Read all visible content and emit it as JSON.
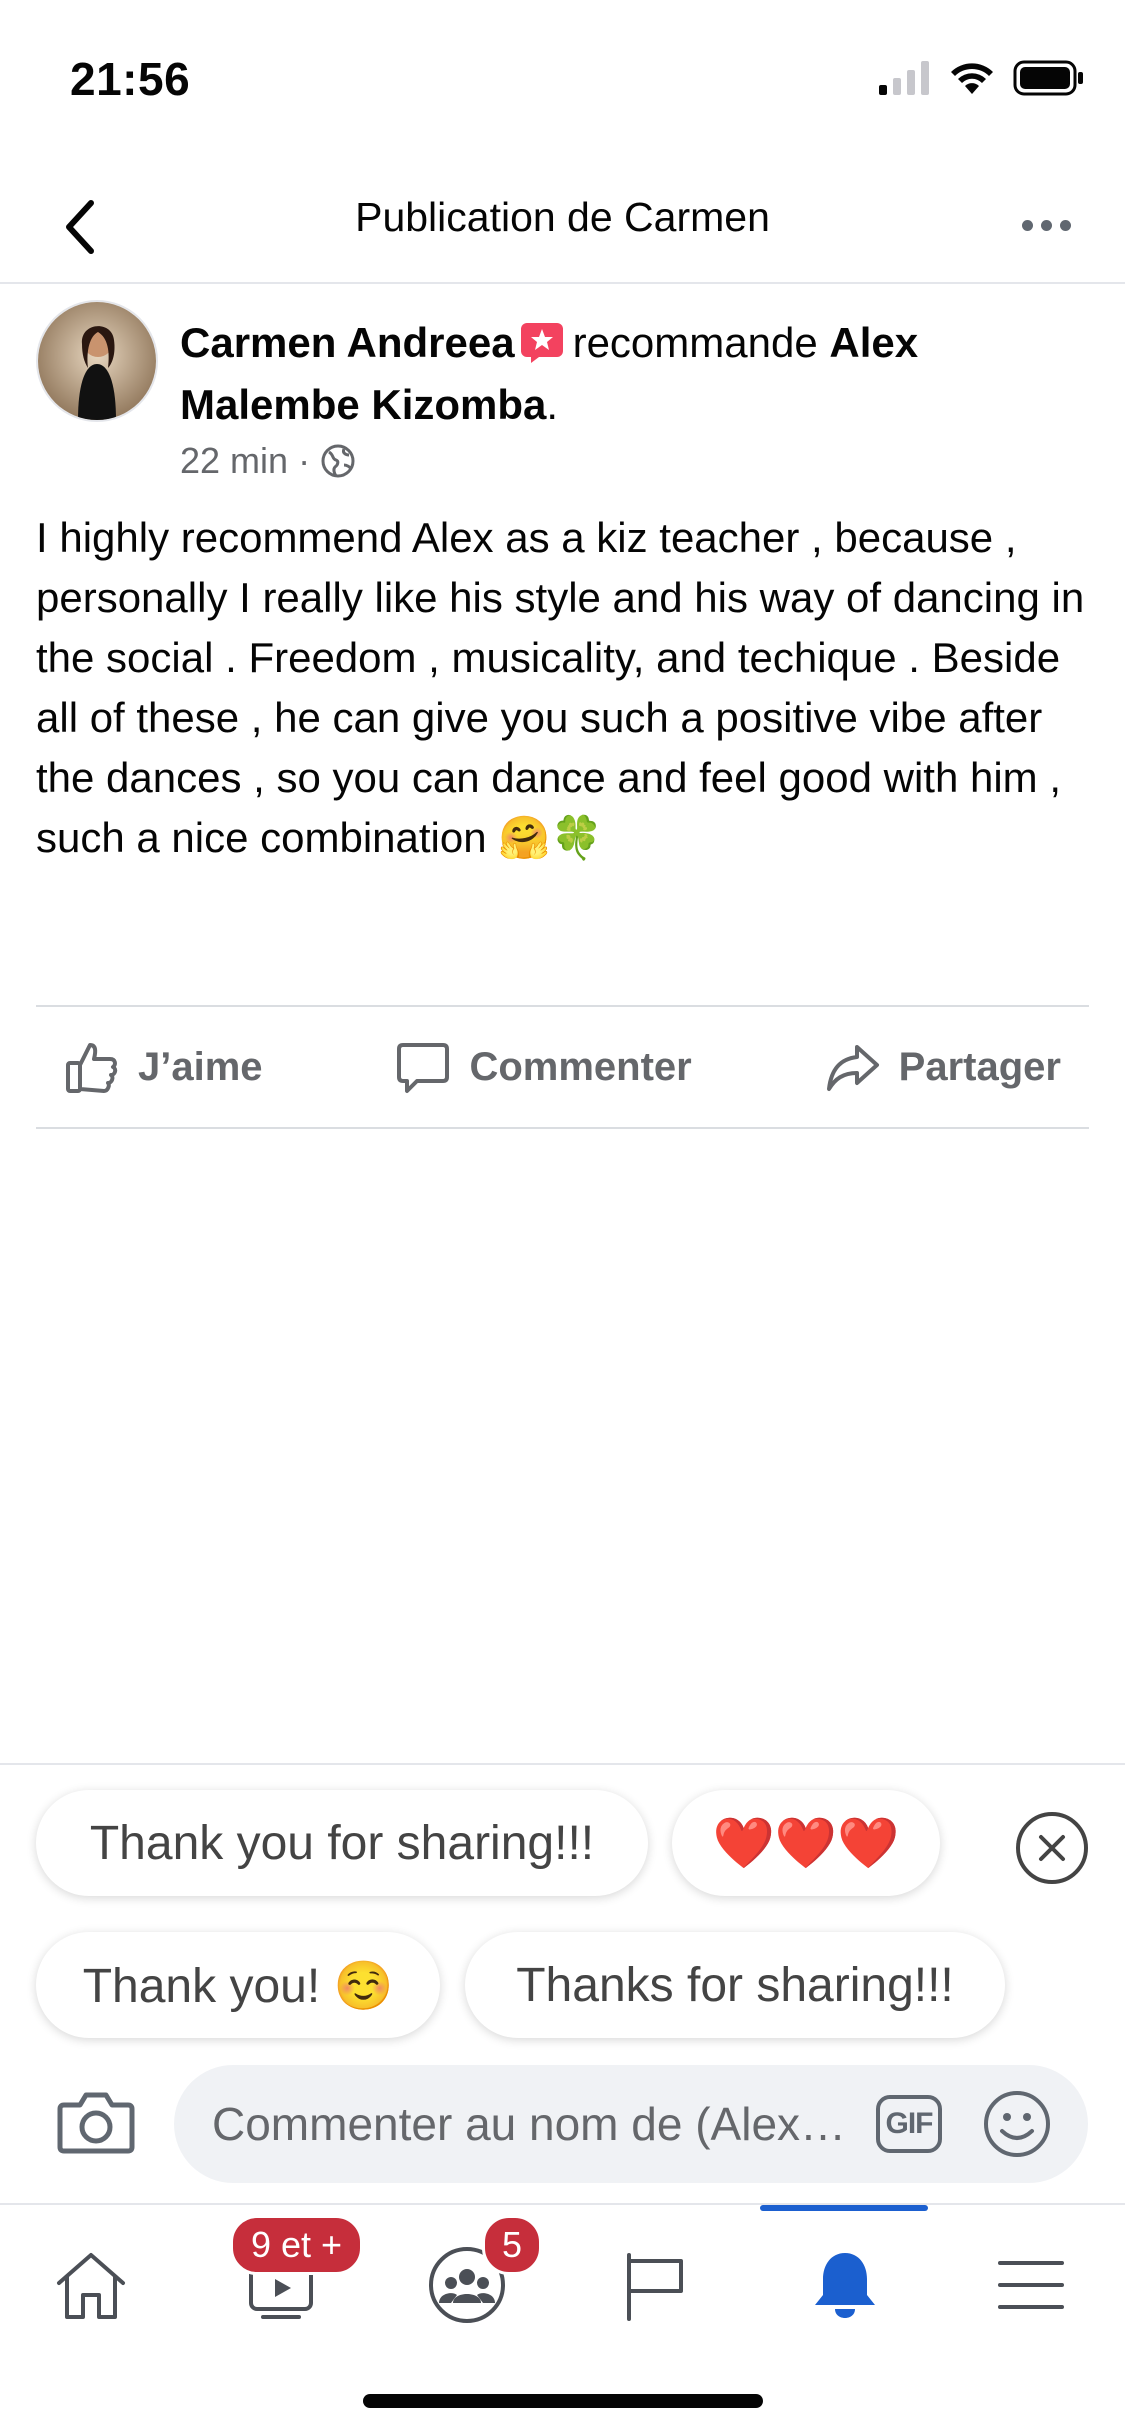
{
  "status": {
    "time": "21:56"
  },
  "nav": {
    "title": "Publication de Carmen"
  },
  "post": {
    "author": "Carmen Andreea",
    "verb": "recommande",
    "page": "Alex Malembe Kizomba",
    "page_suffix": ".",
    "time": "22 min",
    "separator": "·",
    "body": "I highly recommend Alex as a kiz teacher , because , personally I really like his style and his way of dancing in the social . Freedom , musicality,  and techique . Beside all of these , he can give you such a positive vibe after the dances , so you can dance and feel good with him , such a nice combination",
    "body_emojis": "🤗🍀"
  },
  "actions": {
    "like_label": "J’aime",
    "comment_label": "Commenter",
    "share_label": "Partager"
  },
  "quick_replies": {
    "items": [
      "Thank you for sharing!!!",
      "❤️❤️❤️",
      "Thank you! ☺️",
      "Thanks for sharing!!!"
    ]
  },
  "composer": {
    "placeholder": "Commenter au nom de (Alex…",
    "gif_label": "GIF"
  },
  "tabs": {
    "watch_badge": "9 et +",
    "groups_badge": "5",
    "active_color": "#1b5fcf"
  },
  "colors": {
    "badge": "#c62e3b",
    "muted": "#65676b"
  }
}
